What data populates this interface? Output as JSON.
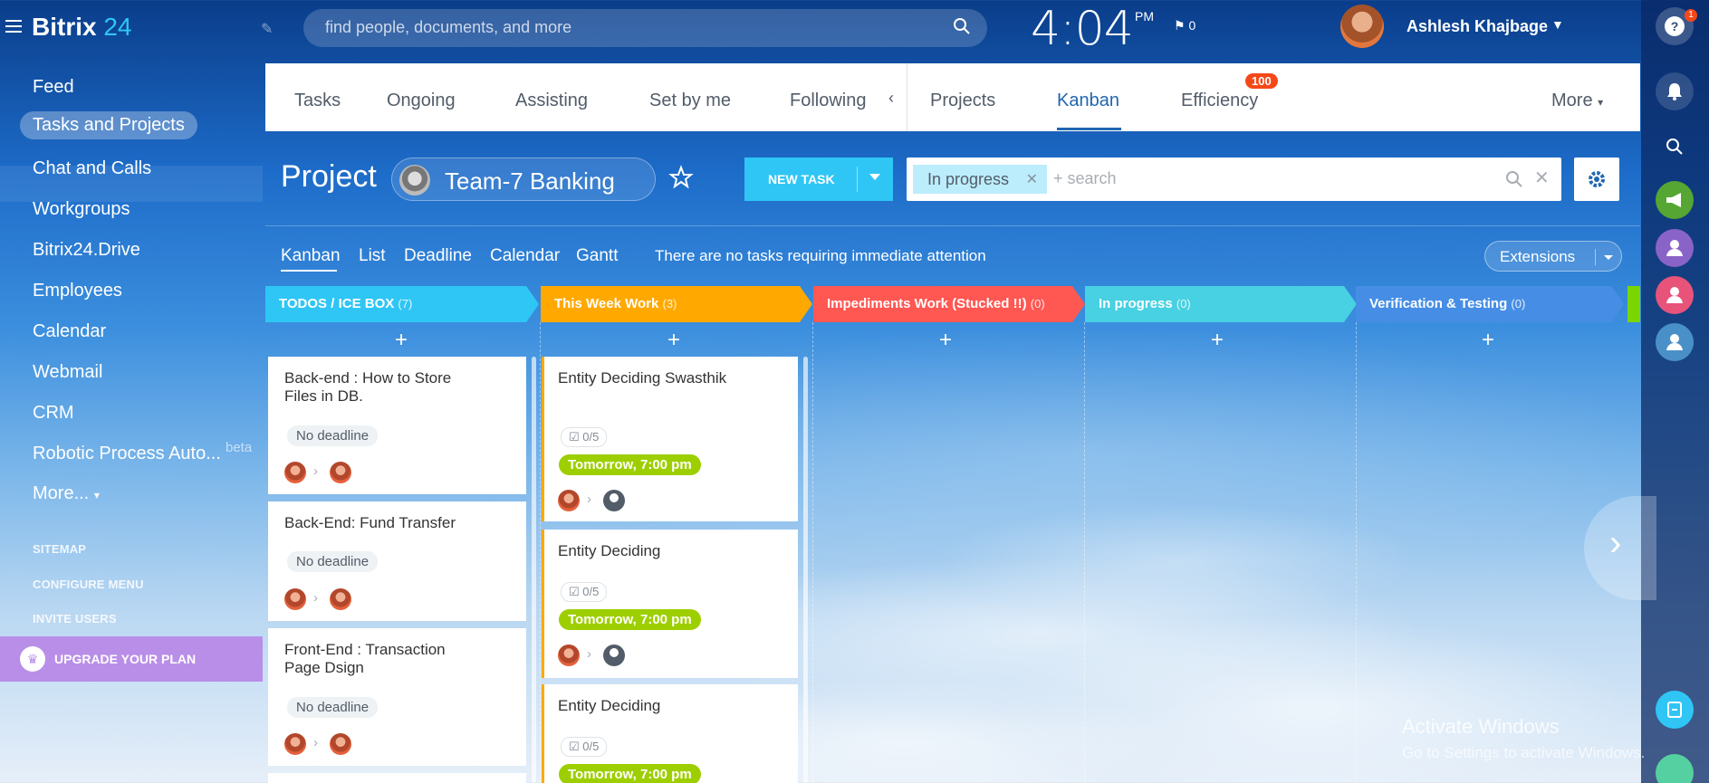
{
  "app": {
    "logo_main": "Bitrix",
    "logo_num": "24"
  },
  "header": {
    "search_placeholder": "find people, documents, and more",
    "clock_time": "4:04",
    "clock_ampm": "PM",
    "flag_count": "0",
    "user_name": "Ashlesh Khajbage"
  },
  "sidebar": {
    "items": [
      {
        "label": "Feed"
      },
      {
        "label": "Tasks and Projects"
      },
      {
        "label": "Chat and Calls"
      },
      {
        "label": "Workgroups"
      },
      {
        "label": "Bitrix24.Drive"
      },
      {
        "label": "Employees"
      },
      {
        "label": "Calendar"
      },
      {
        "label": "Webmail"
      },
      {
        "label": "CRM"
      },
      {
        "label": "Robotic Process Auto..."
      },
      {
        "label": "More..."
      }
    ],
    "beta": "beta",
    "more_caret": "▾",
    "links": {
      "sitemap": "SITEMAP",
      "configure": "CONFIGURE MENU",
      "invite": "INVITE USERS"
    },
    "upgrade": "UPGRADE YOUR PLAN"
  },
  "rail": {
    "help_badge": "1"
  },
  "tabs": {
    "items": [
      {
        "label": "Tasks"
      },
      {
        "label": "Ongoing"
      },
      {
        "label": "Assisting"
      },
      {
        "label": "Set by me"
      },
      {
        "label": "Following"
      },
      {
        "label": "Projects"
      },
      {
        "label": "Kanban"
      },
      {
        "label": "Efficiency"
      },
      {
        "label": "More"
      }
    ],
    "efficiency_badge": "100",
    "more_caret": "▾"
  },
  "project": {
    "title": "Project",
    "name": "Team-7 Banking",
    "new_task": "NEW TASK",
    "filter_chip": "In progress",
    "filter_search": "+ search"
  },
  "views": {
    "items": [
      "Kanban",
      "List",
      "Deadline",
      "Calendar",
      "Gantt"
    ],
    "attention": "There are no tasks requiring immediate attention",
    "extensions": "Extensions"
  },
  "kanban": {
    "columns": [
      {
        "title": "TODOS / ICE BOX",
        "count": "(7)",
        "color": "#2fc6f6"
      },
      {
        "title": "This Week Work",
        "count": "(3)",
        "color": "#ffa900"
      },
      {
        "title": "Impediments Work (Stucked !!)",
        "count": "(0)",
        "color": "#ff5752"
      },
      {
        "title": "In progress",
        "count": "(0)",
        "color": "#47d1e2"
      },
      {
        "title": "Verification & Testing",
        "count": "(0)",
        "color": "#468ee5"
      }
    ],
    "col1_cards": [
      {
        "title": "Back-end : How to Store Files in DB.",
        "deadline": "No deadline"
      },
      {
        "title": "Back-End: Fund Transfer",
        "deadline": "No deadline"
      },
      {
        "title": "Front-End : Transaction Page Dsign",
        "deadline": "No deadline"
      }
    ],
    "col2_cards": [
      {
        "title": "Entity Deciding Swasthik",
        "checklist": "0/5",
        "deadline": "Tomorrow, 7:00 pm"
      },
      {
        "title": "Entity Deciding",
        "checklist": "0/5",
        "deadline": "Tomorrow, 7:00 pm"
      },
      {
        "title": "Entity Deciding",
        "checklist": "0/5",
        "deadline": "Tomorrow, 7:00 pm"
      }
    ]
  },
  "watermark": {
    "line1": "Activate Windows",
    "line2": "Go to Settings to activate Windows."
  }
}
